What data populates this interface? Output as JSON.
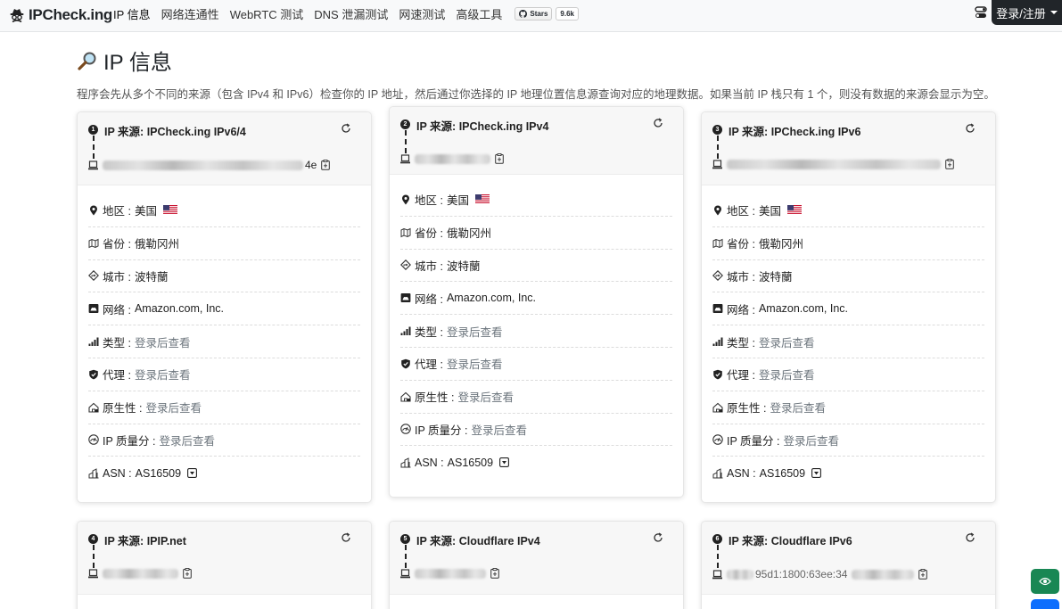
{
  "nav": {
    "brand": "IPCheck.ing",
    "links": [
      "IP 信息",
      "网络连通性",
      "WebRTC 测试",
      "DNS 泄漏测试",
      "网速测试",
      "高级工具"
    ],
    "github_stars_label": "Stars",
    "github_count": "9.6k",
    "login_label": "登录/注册"
  },
  "header": {
    "title": "IP 信息",
    "intro": "程序会先从多个不同的来源（包含 IPv4 和 IPv6）检查你的 IP 地址，然后通过你选择的 IP 地理位置信息源查询对应的地理数据。如果当前 IP 栈只有 1 个，则没有数据的来源会显示为空。"
  },
  "labels": {
    "region": "地区 : ",
    "province": "省份 : ",
    "city": "城市 : ",
    "network": "网络 : ",
    "type": "类型 : ",
    "proxy": "代理 : ",
    "native": "原生性 : ",
    "quality": "IP 质量分 : ",
    "asn": "ASN : "
  },
  "cards": [
    {
      "num": "1",
      "title": "IP 来源: IPCheck.ing IPv6/4",
      "ip_tail": "4e",
      "region": "美国",
      "province": "俄勒冈州",
      "city": "波特蘭",
      "network": "Amazon.com, Inc.",
      "type": "登录后查看",
      "proxy": "登录后查看",
      "native": "登录后查看",
      "quality": "登录后查看",
      "asn": "AS16509"
    },
    {
      "num": "2",
      "title": "IP 来源: IPCheck.ing IPv4",
      "ip_tail": "",
      "region": "美国",
      "province": "俄勒冈州",
      "city": "波特蘭",
      "network": "Amazon.com, Inc.",
      "type": "登录后查看",
      "proxy": "登录后查看",
      "native": "登录后查看",
      "quality": "登录后查看",
      "asn": "AS16509"
    },
    {
      "num": "3",
      "title": "IP 来源: IPCheck.ing IPv6",
      "ip_tail": "",
      "region": "美国",
      "province": "俄勒冈州",
      "city": "波特蘭",
      "network": "Amazon.com, Inc.",
      "type": "登录后查看",
      "proxy": "登录后查看",
      "native": "登录后查看",
      "quality": "登录后查看",
      "asn": "AS16509"
    },
    {
      "num": "4",
      "title": "IP 来源: IPIP.net"
    },
    {
      "num": "5",
      "title": "IP 来源: Cloudflare IPv4"
    },
    {
      "num": "6",
      "title": "IP 来源: Cloudflare IPv6",
      "ip_tail": "95d1:1800:63ee:34"
    }
  ],
  "icons": {
    "brand": "spy-logo-icon",
    "page_title": "magnifier-icon",
    "refresh": "refresh-icon",
    "copy": "clipboard-icon",
    "theme": "theme-toggle-icon",
    "fab": "eye-icon"
  },
  "colors": {
    "login_bg": "#212529",
    "fab_green": "#198754",
    "fab_blue": "#0d6efd",
    "muted": "#6c757d"
  }
}
